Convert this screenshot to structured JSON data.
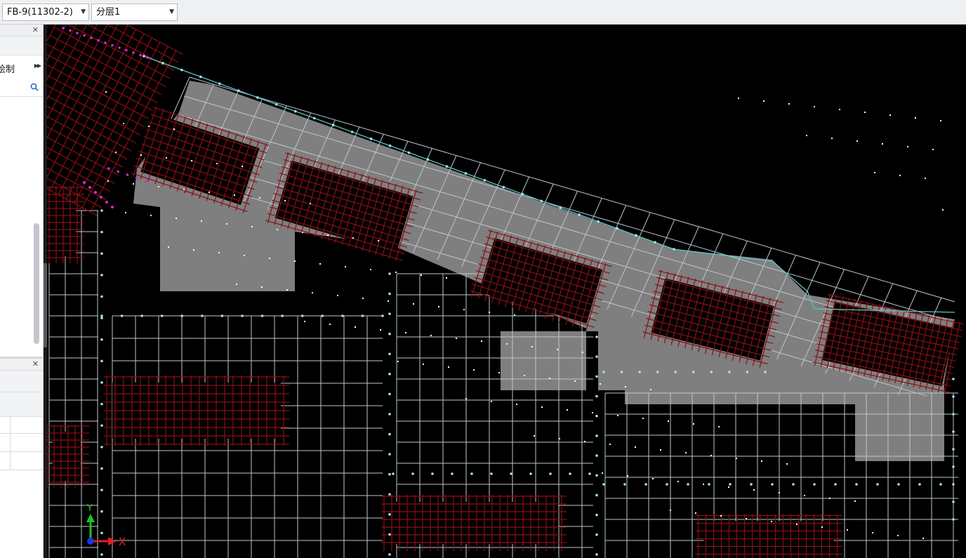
{
  "toolbar": {
    "floor_select": {
      "value": "FB-9(11302-2)"
    },
    "layer_select": {
      "value": "分层1"
    }
  },
  "left_panel_top": {
    "tab_label": "绘制",
    "search": {
      "placeholder": ""
    }
  },
  "axis_indicator": {
    "x_label": "X",
    "y_label": "Y"
  },
  "icons": {
    "close": "close-icon",
    "search": "search-icon",
    "dropdown": "chevron-down-icon",
    "expand": "double-chevron-right-icon"
  },
  "colors": {
    "canvas_bg": "#000000",
    "grid": "#bfc6cc",
    "rebar": "#8b0f14",
    "slab": "#7f7f7f",
    "axis_dot": "#5fc4c7",
    "magenta": "#d12bd1",
    "axis_x": "#e02020",
    "axis_y": "#20c020"
  }
}
